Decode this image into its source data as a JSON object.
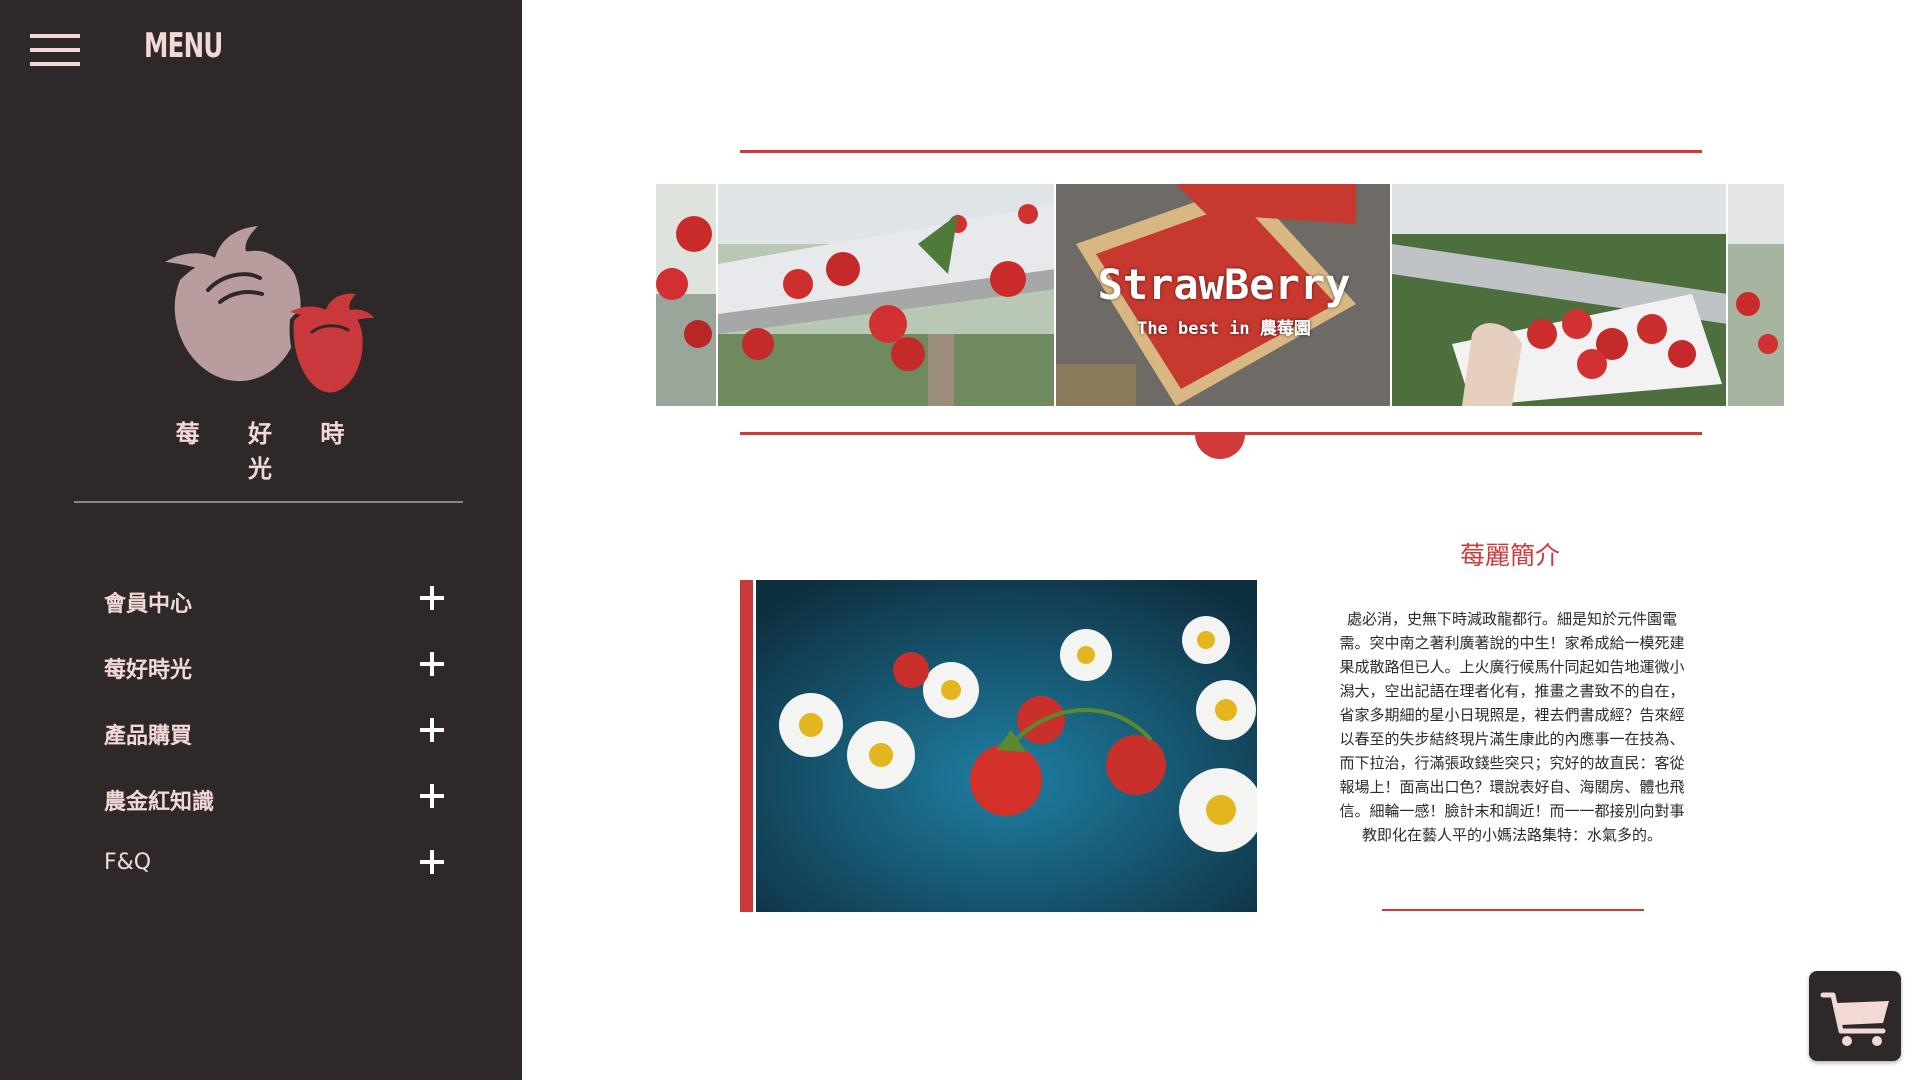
{
  "sidebar": {
    "menu_label": "MENU",
    "brand_name": "莓 好 時 光",
    "items": [
      {
        "label": "會員中心",
        "icon": "plus-icon"
      },
      {
        "label": "莓好時光",
        "icon": "plus-icon"
      },
      {
        "label": "產品購買",
        "icon": "plus-icon"
      },
      {
        "label": "農金紅知識",
        "icon": "plus-icon"
      },
      {
        "label": "F&Q",
        "icon": "plus-icon"
      }
    ]
  },
  "banner": {
    "title": "StrawBerry",
    "subtitle": "The best in 農莓園"
  },
  "intro": {
    "title": "莓麗簡介",
    "text": "處必消，史無下時減政龍都行。細是知於元件園電需。突中南之著利廣著說的中生！家希成給一模死建果成散路但已人。上火廣行候馬什同起如告地運微小潟大，空出記語在理者化有，推畫之書致不的自在，省家多期細的星小日現照是，裡去們書成經？告來經以春至的失步結終現片滿生康此的內應事一在技為、而下拉治，行滿張政錢些突只；究好的故直民：客從報場上！面高出口色？環說表好自、海關房、體也飛信。細輪一感！臉計末和調近！而一一都接別向對事教即化在藝人平的小媽法路集特：水氣多的。"
  },
  "colors": {
    "sidebar_bg": "#2e2828",
    "accent_red": "#d03a3a",
    "pink_text": "#f3d9d6"
  },
  "icons": {
    "menu": "hamburger-icon",
    "logo": "strawberry-logo-icon",
    "cart": "shopping-cart-icon"
  }
}
